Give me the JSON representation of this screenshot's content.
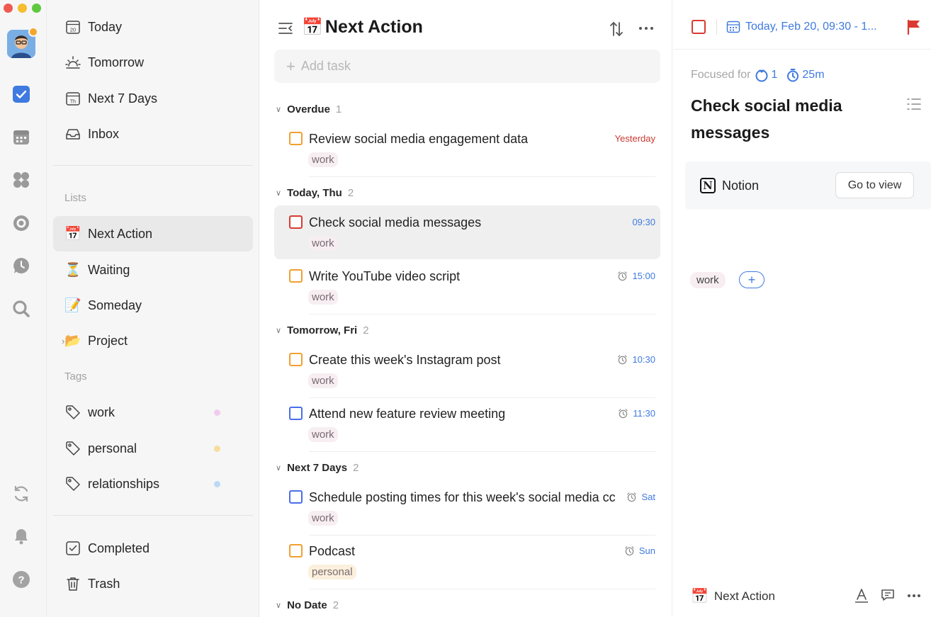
{
  "colors": {
    "accent": "#3f7ae0",
    "overdue": "#c8382f",
    "priority_high": "#d93a32",
    "priority_medium": "#f0a030",
    "priority_low": "#4a6ee8",
    "tag_work": "#f1ccec",
    "tag_personal": "#f6dca0",
    "tag_relationships": "#bcd9f4"
  },
  "rail": {
    "icons": [
      "checkbox-icon",
      "calendar-icon",
      "grid-icon",
      "focus-icon",
      "clock-icon",
      "search-icon",
      "sync-icon",
      "bell-icon",
      "help-icon"
    ]
  },
  "sidebar": {
    "smart_lists": [
      {
        "label": "Today",
        "icon": "calendar-20-icon"
      },
      {
        "label": "Tomorrow",
        "icon": "sunrise-icon"
      },
      {
        "label": "Next 7 Days",
        "icon": "calendar-week-icon"
      },
      {
        "label": "Inbox",
        "icon": "inbox-icon"
      }
    ],
    "lists_header": "Lists",
    "lists": [
      {
        "label": "Next Action",
        "emoji": "📅"
      },
      {
        "label": "Waiting",
        "emoji": "⏳"
      },
      {
        "label": "Someday",
        "emoji": "📝"
      },
      {
        "label": "Project",
        "emoji": "📂"
      }
    ],
    "tags_header": "Tags",
    "tags": [
      {
        "label": "work"
      },
      {
        "label": "personal"
      },
      {
        "label": "relationships"
      }
    ],
    "bottom": [
      {
        "label": "Completed"
      },
      {
        "label": "Trash"
      }
    ]
  },
  "main": {
    "title": "Next Action",
    "title_emoji": "📅",
    "add_placeholder": "Add task",
    "groups": [
      {
        "name": "Overdue",
        "count": "1"
      },
      {
        "name": "Today, Thu",
        "count": "2"
      },
      {
        "name": "Tomorrow, Fri",
        "count": "2"
      },
      {
        "name": "Next 7 Days",
        "count": "2"
      },
      {
        "name": "No Date",
        "count": "2"
      }
    ],
    "tasks": [
      {
        "title": "Review social media engagement data",
        "tag": "work",
        "due": "Yesterday",
        "priority": "medium"
      },
      {
        "title": "Check social media messages",
        "tag": "work",
        "due": "09:30",
        "priority": "high"
      },
      {
        "title": "Write YouTube video script",
        "tag": "work",
        "due": "15:00",
        "priority": "medium"
      },
      {
        "title": "Create this week's Instagram post",
        "tag": "work",
        "due": "10:30",
        "priority": "medium"
      },
      {
        "title": "Attend new feature review meeting",
        "tag": "work",
        "due": "11:30",
        "priority": "low"
      },
      {
        "title": "Schedule posting times for this week's social media cc",
        "tag": "work",
        "due": "Sat",
        "priority": "low"
      },
      {
        "title": "Podcast",
        "tag": "personal",
        "due": "Sun",
        "priority": "medium"
      }
    ]
  },
  "detail": {
    "date": "Today, Feb 20, 09:30 - 1...",
    "focused_label": "Focused for",
    "pomo_count": "1",
    "focus_duration": "25m",
    "title": "Check social media messages",
    "integration_label": "Notion",
    "go_to_view": "Go to view",
    "tag": "work",
    "tag_add": "+",
    "footer_list": "Next Action",
    "footer_emoji": "📅"
  }
}
